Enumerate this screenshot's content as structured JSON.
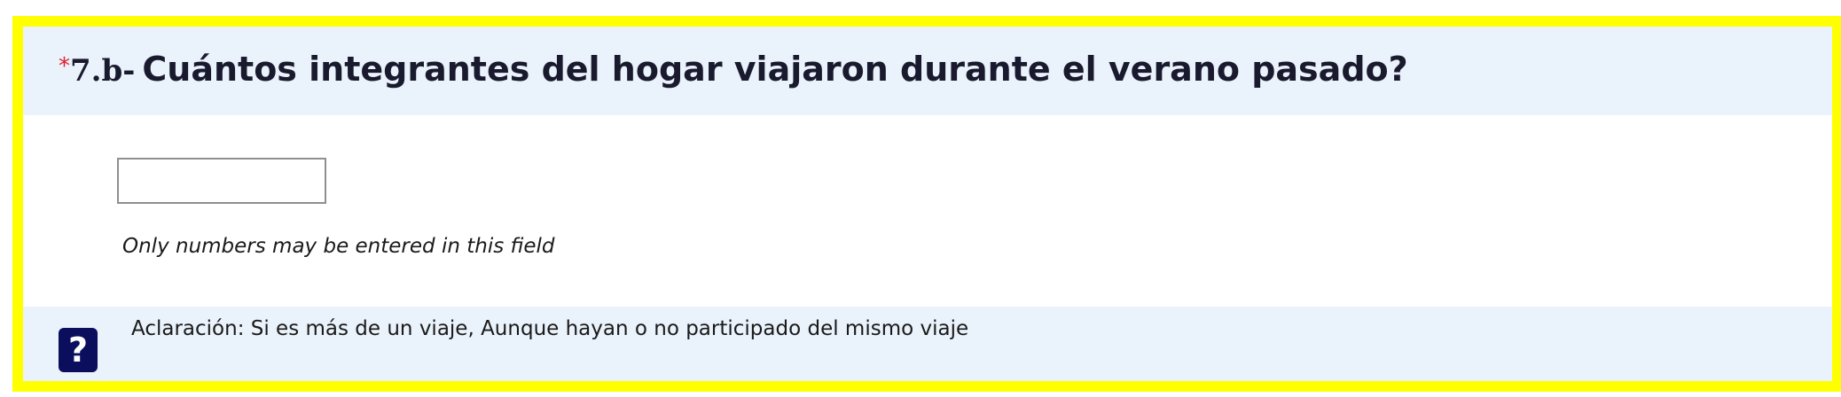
{
  "question": {
    "required_marker": "*",
    "number": "7.b-",
    "text": "Cuántos integrantes del hogar viajaron durante el verano pasado?"
  },
  "answer_input": {
    "value": "",
    "placeholder": ""
  },
  "validation_hint": "Only numbers may be entered in this field",
  "help": {
    "icon": "question-mark-icon",
    "icon_glyph": "?",
    "text": "Aclaración: Si es más de un viaje, Aunque hayan o no participado del mismo viaje"
  },
  "colors": {
    "frame_highlight": "#ffff00",
    "header_background": "#eaf2fb",
    "required_marker": "#e0202f",
    "help_icon_background": "#0b0e5c"
  }
}
